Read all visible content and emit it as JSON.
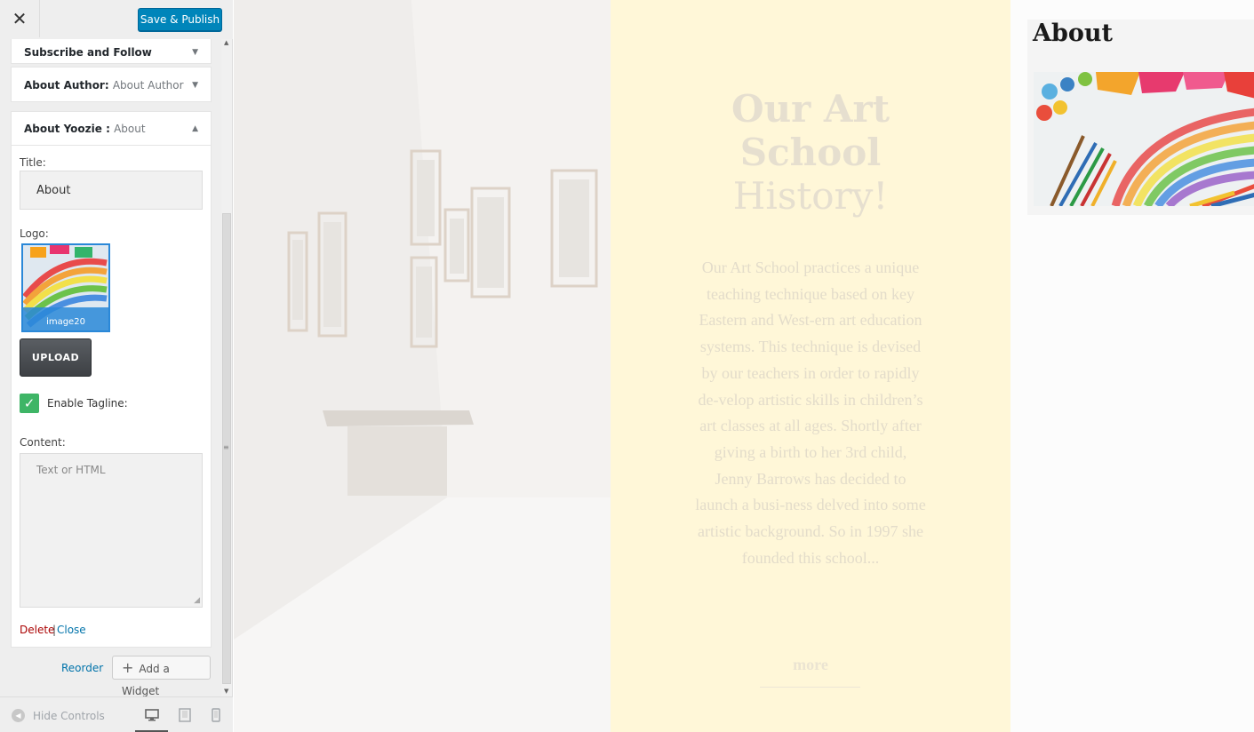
{
  "header": {
    "close_label": "✕",
    "save_label": "Save & Publish"
  },
  "widgets": {
    "subscribe": {
      "title": "Subscribe and Follow"
    },
    "author": {
      "title": "About Author:",
      "subtitle": "About Author"
    },
    "about": {
      "title": "About Yoozie :",
      "subtitle": "About",
      "title_label": "Title:",
      "title_value": "About",
      "logo_label": "Logo:",
      "logo_filename": "image20",
      "upload_label": "UPLOAD",
      "tagline_label": "Enable Tagline:",
      "tagline_checked": true,
      "content_label": "Content:",
      "content_placeholder": "Text or HTML",
      "delete_label": "Delete",
      "separator": "|",
      "close_label": "Close"
    }
  },
  "widget_actions": {
    "reorder_label": "Reorder",
    "add_widget_label": "Add a Widget"
  },
  "footer": {
    "hide_controls_label": "Hide Controls",
    "active_device": "desktop"
  },
  "preview": {
    "hero_title_line1": "Our Art",
    "hero_title_line2": "School",
    "hero_title_line3": "History!",
    "hero_body": "Our Art School practices a unique teaching technique based on key Eastern and West-ern art education systems. This technique is devised by our teachers in order to rapidly de-velop artistic skills in children’s art classes at all ages. Shortly after giving a birth to her 3rd child, Jenny Barrows has decided to launch a busi-ness delved into some artistic background. So in 1997 she founded this school...",
    "more_label": "more",
    "about_heading": "About"
  },
  "colors": {
    "accent": "#0085ba",
    "check_green": "#3eb566",
    "delete_red": "#aa0000",
    "link_blue": "#0073aa",
    "hero_panel": "#fff7d8"
  }
}
